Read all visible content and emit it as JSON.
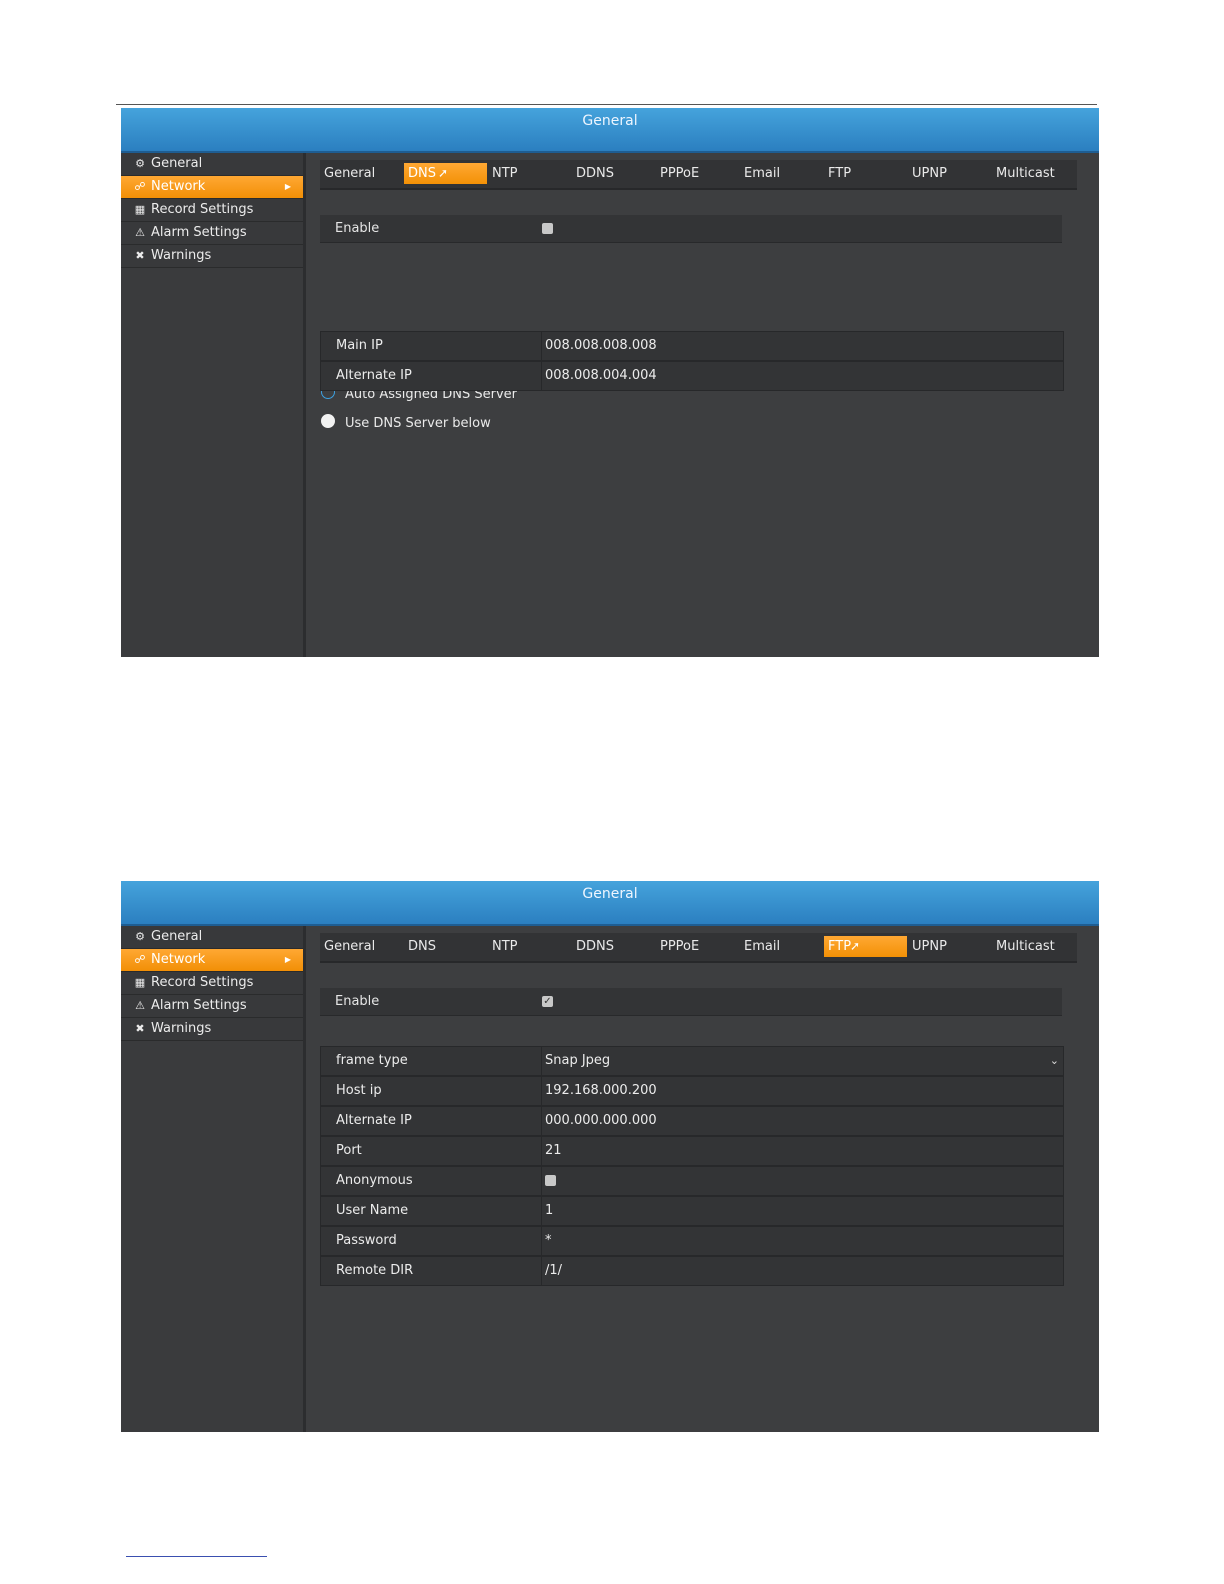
{
  "title": "General",
  "sidebar": [
    {
      "label": "General",
      "icon": "gear-icon"
    },
    {
      "label": "Network",
      "icon": "network-icon",
      "active": true
    },
    {
      "label": "Record Settings",
      "icon": "film-icon"
    },
    {
      "label": "Alarm Settings",
      "icon": "warning-triangle-icon"
    },
    {
      "label": "Warnings",
      "icon": "tools-icon"
    }
  ],
  "tabs": [
    "General",
    "DNS",
    "NTP",
    "DDNS",
    "PPPoE",
    "Email",
    "FTP",
    "UPNP",
    "Multicast"
  ],
  "dns": {
    "active_tab": "DNS",
    "enable_label": "Enable",
    "enabled": false,
    "radio_auto": "Auto Assigned DNS Server",
    "radio_manual": "Use DNS Server below",
    "main_ip_label": "Main IP",
    "main_ip": "008.008.008.008",
    "alt_ip_label": "Alternate IP",
    "alt_ip": "008.008.004.004"
  },
  "ftp": {
    "active_tab": "FTP",
    "enable_label": "Enable",
    "enabled": true,
    "rows": [
      {
        "label": "frame type",
        "value": "Snap Jpeg"
      },
      {
        "label": "Host ip",
        "value": "192.168.000.200"
      },
      {
        "label": "Alternate IP",
        "value": "000.000.000.000"
      },
      {
        "label": "Port",
        "value": "21"
      },
      {
        "label": "Anonymous",
        "value": ""
      },
      {
        "label": "User Name",
        "value": "1"
      },
      {
        "label": "Password",
        "value": "*"
      },
      {
        "label": "Remote DIR",
        "value": "/1/"
      }
    ]
  }
}
